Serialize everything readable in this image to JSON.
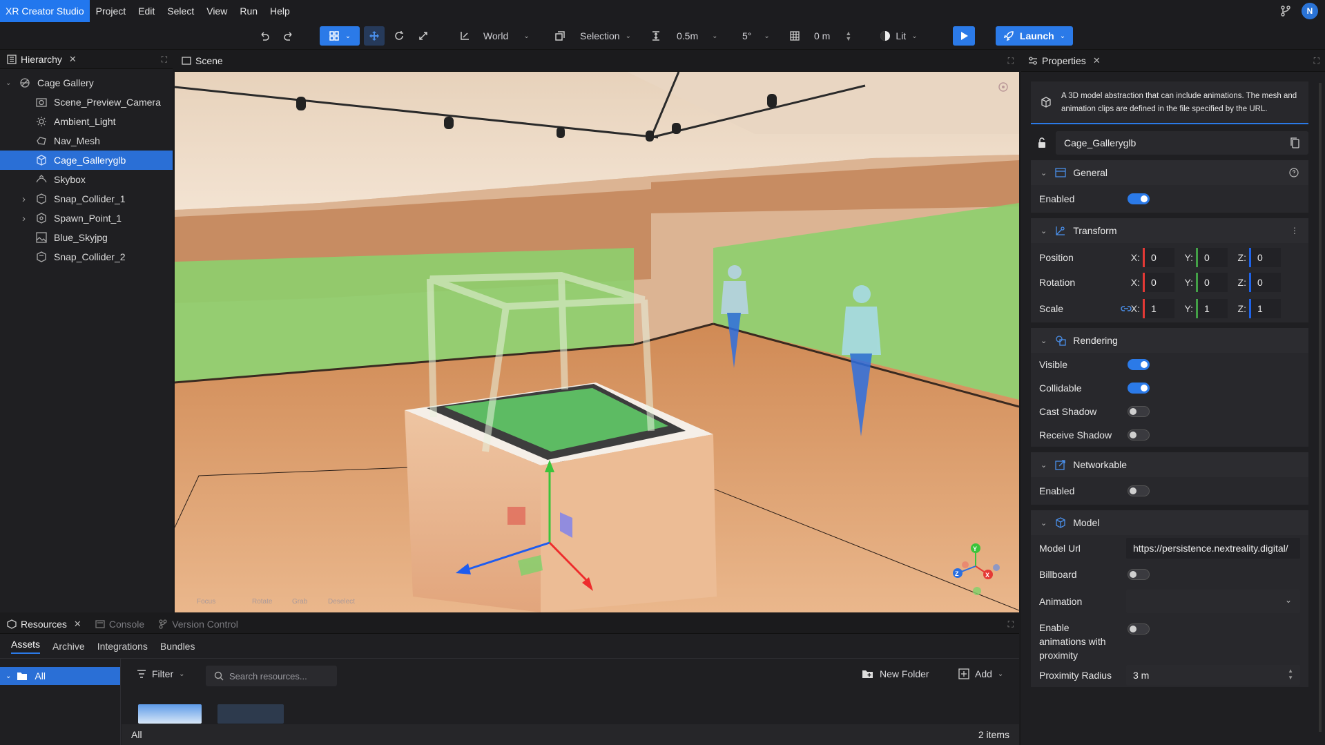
{
  "app": {
    "title": "XR Creator Studio"
  },
  "menu": [
    "Project",
    "Edit",
    "Select",
    "View",
    "Run",
    "Help"
  ],
  "user": {
    "initial": "N"
  },
  "toolbar": {
    "space": "World",
    "select_mode": "Selection",
    "translate_snap": "0.5m",
    "rotate_snap": "5°",
    "grid_height": "0 m",
    "render_mode": "Lit",
    "launch": "Launch"
  },
  "hierarchy": {
    "tab": "Hierarchy",
    "root": "Cage Gallery",
    "items": [
      {
        "label": "Scene_Preview_Camera",
        "icon": "camera-icon",
        "selected": false,
        "expandable": false
      },
      {
        "label": "Ambient_Light",
        "icon": "light-icon",
        "selected": false,
        "expandable": false
      },
      {
        "label": "Nav_Mesh",
        "icon": "navmesh-icon",
        "selected": false,
        "expandable": false
      },
      {
        "label": "Cage_Galleryglb",
        "icon": "model-icon",
        "selected": true,
        "expandable": false
      },
      {
        "label": "Skybox",
        "icon": "skybox-icon",
        "selected": false,
        "expandable": false
      },
      {
        "label": "Snap_Collider_1",
        "icon": "collider-icon",
        "selected": false,
        "expandable": true
      },
      {
        "label": "Spawn_Point_1",
        "icon": "spawn-icon",
        "selected": false,
        "expandable": true
      },
      {
        "label": "Blue_Skyjpg",
        "icon": "image-icon",
        "selected": false,
        "expandable": false
      },
      {
        "label": "Snap_Collider_2",
        "icon": "collider-icon",
        "selected": false,
        "expandable": false
      }
    ]
  },
  "scene": {
    "tab": "Scene",
    "hints": [
      "Focus",
      "Rotate",
      "Grab",
      "Deselect"
    ],
    "gizmo": {
      "x": "X",
      "y": "Y",
      "z": "Z"
    }
  },
  "properties": {
    "tab": "Properties",
    "description": "A 3D model abstraction that can include animations. The mesh and animation clips are defined in the file specified by the URL.",
    "name": "Cage_Galleryglb",
    "general": {
      "title": "General",
      "enabled_label": "Enabled",
      "enabled": true
    },
    "transform": {
      "title": "Transform",
      "position": {
        "label": "Position",
        "x": "0",
        "y": "0",
        "z": "0"
      },
      "rotation": {
        "label": "Rotation",
        "x": "0",
        "y": "0",
        "z": "0"
      },
      "scale": {
        "label": "Scale",
        "x": "1",
        "y": "1",
        "z": "1"
      },
      "axis_x": "X:",
      "axis_y": "Y:",
      "axis_z": "Z:"
    },
    "rendering": {
      "title": "Rendering",
      "visible_label": "Visible",
      "visible": true,
      "collidable_label": "Collidable",
      "collidable": true,
      "cast_shadow_label": "Cast Shadow",
      "cast_shadow": false,
      "receive_shadow_label": "Receive Shadow",
      "receive_shadow": false
    },
    "networkable": {
      "title": "Networkable",
      "enabled_label": "Enabled",
      "enabled": false
    },
    "model": {
      "title": "Model",
      "url_label": "Model Url",
      "url": "https://persistence.nextreality.digital/",
      "billboard_label": "Billboard",
      "billboard": false,
      "animation_label": "Animation",
      "animation": "",
      "proximity_label": "Enable animations with proximity",
      "proximity": false,
      "radius_label": "Proximity Radius",
      "radius": "3 m"
    }
  },
  "bottom": {
    "tabs": [
      "Resources",
      "Console",
      "Version Control"
    ],
    "subtabs": [
      "Assets",
      "Archive",
      "Integrations",
      "Bundles"
    ],
    "folder": "All",
    "filter": "Filter",
    "search_placeholder": "Search resources...",
    "new_folder": "New Folder",
    "add": "Add",
    "footer_path": "All",
    "footer_count": "2 items"
  },
  "colors": {
    "accent": "#2b7ae8",
    "axis_x": "#e53935",
    "axis_y": "#43a047",
    "axis_z": "#1e63e9"
  }
}
